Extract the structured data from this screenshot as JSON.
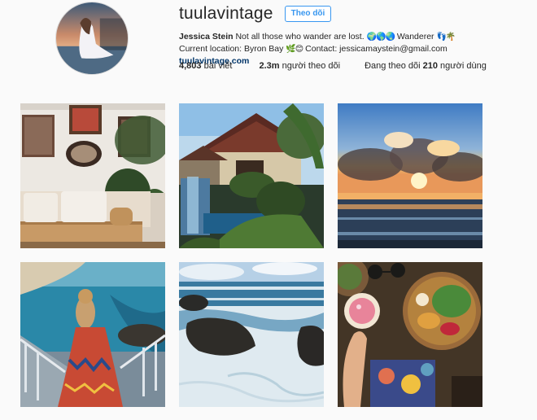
{
  "profile": {
    "username": "tuulavintage",
    "follow_label": "Theo dõi",
    "full_name": "Jessica Stein",
    "bio_text": "Not all those who wander are lost.",
    "bio_emojis_1": "🌍🌎🌏",
    "bio_wanderer": "Wanderer",
    "bio_emojis_2": "👣🌴",
    "bio_current": "Current location: Byron Bay",
    "bio_emojis_3": "🌿😊",
    "bio_contact": "Contact: jessicamaystein@gmail.com",
    "website": "tuulavintage.com"
  },
  "stats": {
    "posts_count": "4,803",
    "posts_label": "bài viết",
    "followers_count": "2.3m",
    "followers_label": "người theo dõi",
    "following_prefix": "Đang theo dõi",
    "following_count": "210",
    "following_suffix": "người dùng"
  },
  "posts": [
    {
      "subject": "living-room-interior"
    },
    {
      "subject": "tropical-villa-pool"
    },
    {
      "subject": "sunset-beach"
    },
    {
      "subject": "woman-on-beach-stairs"
    },
    {
      "subject": "rocky-shore-waves"
    },
    {
      "subject": "food-flatlay-smoothie-bowl"
    }
  ]
}
